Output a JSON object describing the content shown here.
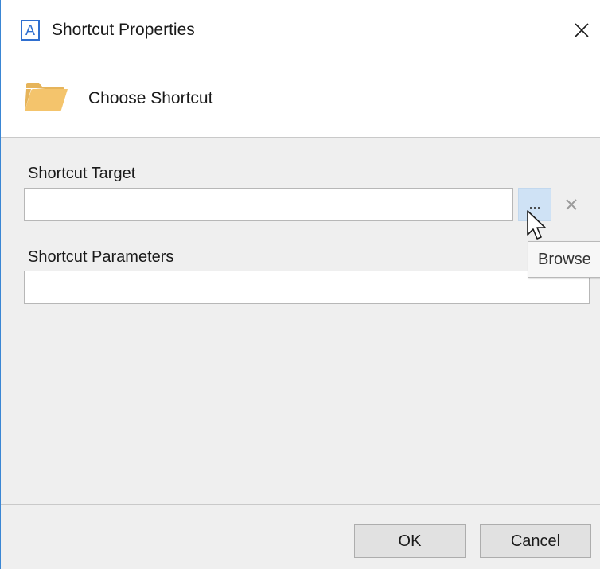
{
  "window": {
    "app_icon_letter": "A",
    "title": "Shortcut Properties"
  },
  "header": {
    "title": "Choose Shortcut"
  },
  "form": {
    "target_label": "Shortcut Target",
    "target_value": "",
    "browse_label": "...",
    "params_label": "Shortcut Parameters",
    "params_value": ""
  },
  "tooltip": {
    "text": "Browse"
  },
  "footer": {
    "ok_label": "OK",
    "cancel_label": "Cancel"
  },
  "colors": {
    "accent": "#3a86d4",
    "body_bg": "#efefef",
    "browse_highlight": "#cfe2f5",
    "folder": "#f4c46c"
  }
}
